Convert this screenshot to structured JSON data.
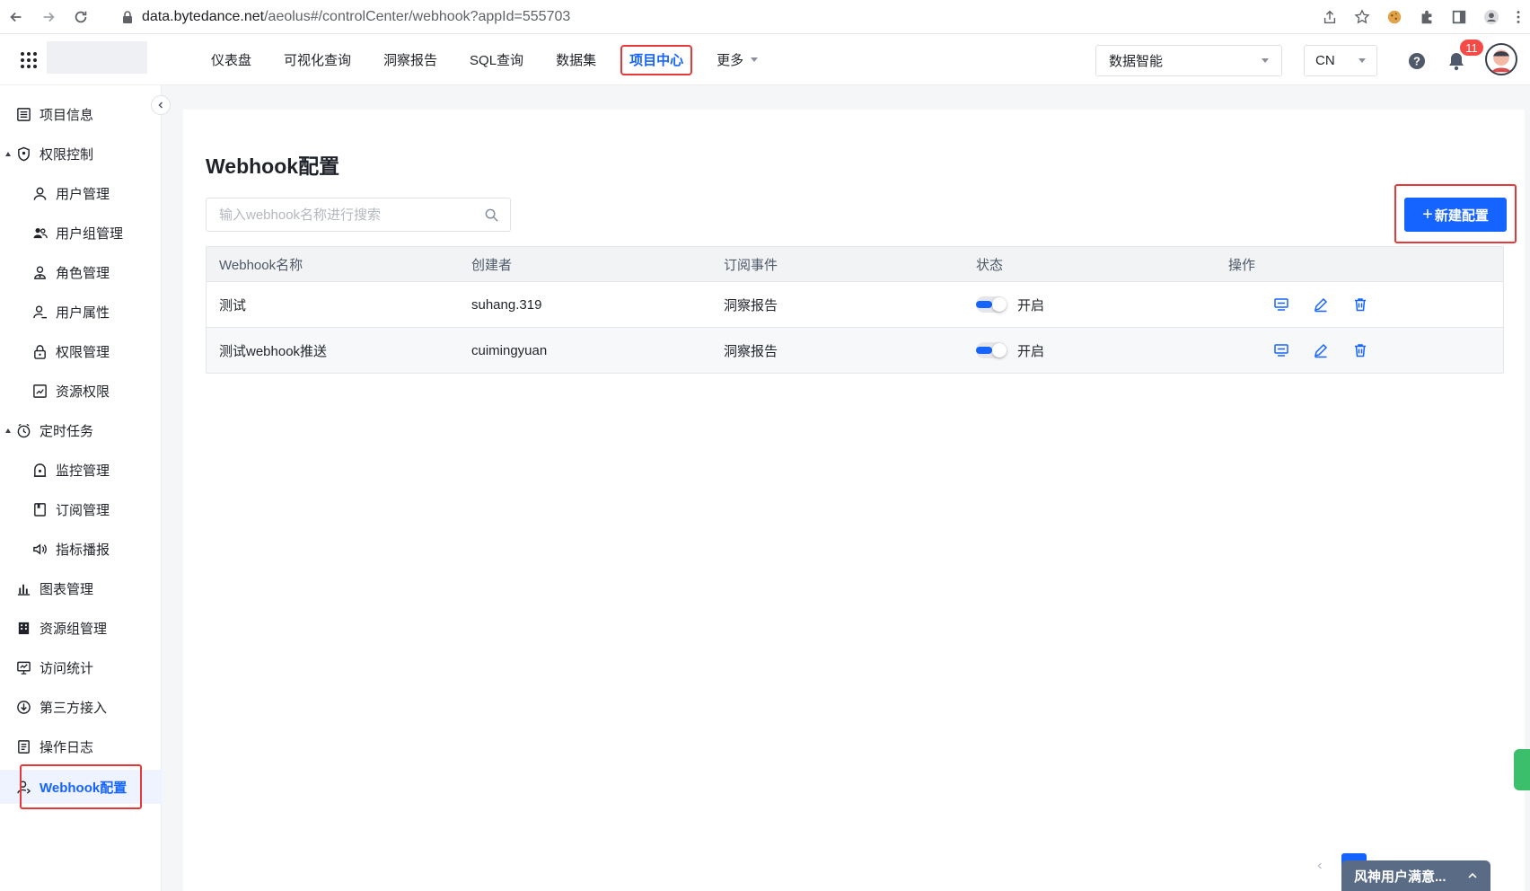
{
  "browser": {
    "url_host": "data.bytedance.net",
    "url_path": "/aeolus#/controlCenter/webhook?appId=555703"
  },
  "header": {
    "nav": [
      {
        "label": "仪表盘"
      },
      {
        "label": "可视化查询"
      },
      {
        "label": "洞察报告"
      },
      {
        "label": "SQL查询"
      },
      {
        "label": "数据集"
      },
      {
        "label": "项目中心",
        "active": true
      },
      {
        "label": "更多",
        "dropdown": true
      }
    ],
    "space_select": "数据智能",
    "lang_select": "CN",
    "notification_count": "11"
  },
  "sidebar": {
    "items": [
      {
        "label": "项目信息",
        "icon": "list-icon",
        "level": 1
      },
      {
        "label": "权限控制",
        "icon": "shield-icon",
        "level": 1,
        "expanded": true
      },
      {
        "label": "用户管理",
        "icon": "user-icon",
        "level": 2
      },
      {
        "label": "用户组管理",
        "icon": "users-icon",
        "level": 2
      },
      {
        "label": "角色管理",
        "icon": "role-icon",
        "level": 2
      },
      {
        "label": "用户属性",
        "icon": "user-attr-icon",
        "level": 2
      },
      {
        "label": "权限管理",
        "icon": "lock-icon",
        "level": 2
      },
      {
        "label": "资源权限",
        "icon": "resource-icon",
        "level": 2
      },
      {
        "label": "定时任务",
        "icon": "clock-icon",
        "level": 1,
        "expanded": true
      },
      {
        "label": "监控管理",
        "icon": "monitor-icon",
        "level": 2
      },
      {
        "label": "订阅管理",
        "icon": "bookmark-icon",
        "level": 2
      },
      {
        "label": "指标播报",
        "icon": "speaker-icon",
        "level": 2
      },
      {
        "label": "图表管理",
        "icon": "chart-icon",
        "level": 1
      },
      {
        "label": "资源组管理",
        "icon": "building-icon",
        "level": 1
      },
      {
        "label": "访问统计",
        "icon": "screen-icon",
        "level": 1
      },
      {
        "label": "第三方接入",
        "icon": "download-icon",
        "level": 1
      },
      {
        "label": "操作日志",
        "icon": "log-icon",
        "level": 1
      },
      {
        "label": "Webhook配置",
        "icon": "webhook-icon",
        "level": 1,
        "active": true
      }
    ]
  },
  "main": {
    "title": "Webhook配置",
    "search_placeholder": "输入webhook名称进行搜索",
    "new_button": "新建配置",
    "columns": [
      "Webhook名称",
      "创建者",
      "订阅事件",
      "状态",
      "操作"
    ],
    "rows": [
      {
        "name": "测试",
        "creator": "suhang.319",
        "event": "洞察报告",
        "status": "开启",
        "enabled": true
      },
      {
        "name": "测试webhook推送",
        "creator": "cuimingyuan",
        "event": "洞察报告",
        "status": "开启",
        "enabled": true
      }
    ],
    "pagination": {
      "current": "1"
    }
  },
  "survey": {
    "label": "风神用户满意..."
  },
  "colors": {
    "accent": "#1664ff",
    "highlight": "#e5393a"
  }
}
